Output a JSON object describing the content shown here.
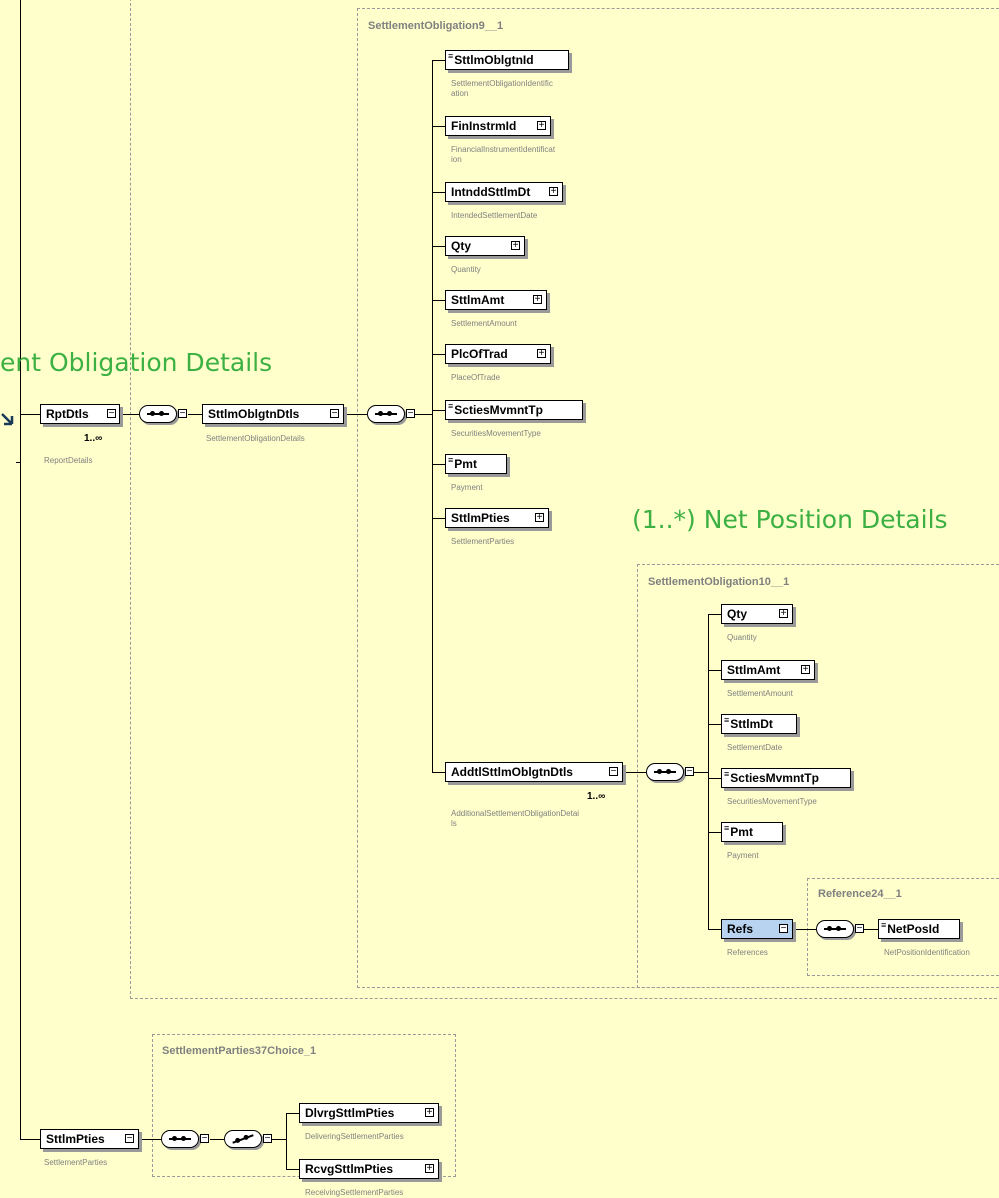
{
  "annotations": {
    "settlement_obligation_details": "ent Obligation Details",
    "net_position_details": "(1..*) Net Position Details"
  },
  "groups": {
    "so9": "SettlementObligation9__1",
    "so10": "SettlementObligation10__1",
    "ref24": "Reference24__1",
    "sp37": "SettlementParties37Choice_1"
  },
  "root": {
    "rpt": {
      "label": "RptDtls",
      "sub": "ReportDetails",
      "card": "1..∞"
    },
    "sttlmpties": {
      "label": "SttlmPties",
      "sub": "SettlementParties"
    }
  },
  "so_details": {
    "label": "SttlmOblgtnDtls",
    "sub": "SettlementObligationDetails"
  },
  "so9_items": [
    {
      "label": "SttlmOblgtnId",
      "sub": "SettlementObligationIdentific\nation"
    },
    {
      "label": "FinInstrmId",
      "sub": "FinancialInstrumentIdentificat\nion"
    },
    {
      "label": "IntnddSttlmDt",
      "sub": "IntendedSettlementDate"
    },
    {
      "label": "Qty",
      "sub": "Quantity"
    },
    {
      "label": "SttlmAmt",
      "sub": "SettlementAmount"
    },
    {
      "label": "PlcOfTrad",
      "sub": "PlaceOfTrade"
    },
    {
      "label": "SctiesMvmntTp",
      "sub": "SecuritiesMovementType"
    },
    {
      "label": "Pmt",
      "sub": "Payment"
    },
    {
      "label": "SttlmPties",
      "sub": "SettlementParties"
    },
    {
      "label": "AddtlSttlmOblgtnDtls",
      "sub": "AdditionalSettlementObligationDetai\nls",
      "card": "1..∞"
    }
  ],
  "so10_items": [
    {
      "label": "Qty",
      "sub": "Quantity"
    },
    {
      "label": "SttlmAmt",
      "sub": "SettlementAmount"
    },
    {
      "label": "SttlmDt",
      "sub": "SettlementDate"
    },
    {
      "label": "SctiesMvmntTp",
      "sub": "SecuritiesMovementType"
    },
    {
      "label": "Pmt",
      "sub": "Payment"
    },
    {
      "label": "Refs",
      "sub": "References"
    }
  ],
  "ref24_items": [
    {
      "label": "NetPosId",
      "sub": "NetPositionIdentification"
    }
  ],
  "sp37_items": [
    {
      "label": "DlvrgSttlmPties",
      "sub": "DeliveringSettlementParties"
    },
    {
      "label": "RcvgSttlmPties",
      "sub": "ReceivingSettlementParties"
    }
  ],
  "colors": {
    "background": "#ffffcc",
    "annotation": "#3cb043",
    "highlight": "#b7d3f0"
  }
}
